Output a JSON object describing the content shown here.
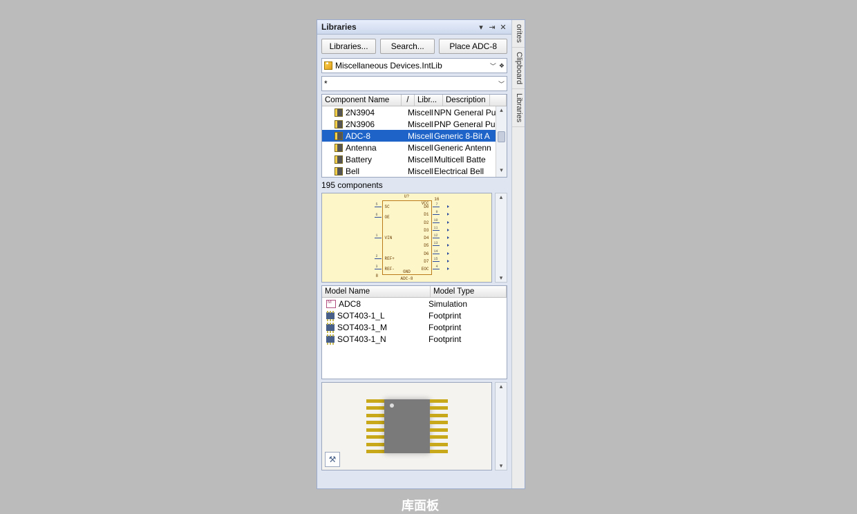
{
  "panel": {
    "title": "Libraries",
    "toolbar": {
      "libraries_btn": "Libraries...",
      "search_btn": "Search...",
      "place_btn": "Place ADC-8"
    },
    "library_combo": "Miscellaneous Devices.IntLib",
    "filter_value": "*",
    "columns": {
      "name": "Component Name",
      "sort": "/",
      "lib": "Libr...",
      "desc": "Description"
    },
    "rows": [
      {
        "name": "2N3904",
        "lib": "Miscell",
        "desc": "NPN General Pu"
      },
      {
        "name": "2N3906",
        "lib": "Miscell",
        "desc": "PNP General Pu"
      },
      {
        "name": "ADC-8",
        "lib": "Miscell",
        "desc": "Generic 8-Bit A",
        "selected": true
      },
      {
        "name": "Antenna",
        "lib": "Miscell",
        "desc": "Generic Antenn"
      },
      {
        "name": "Battery",
        "lib": "Miscell",
        "desc": "Multicell Batte"
      },
      {
        "name": "Bell",
        "lib": "Miscell",
        "desc": "Electrical Bell"
      }
    ],
    "count_text": "195 components",
    "schematic": {
      "designator": "U?",
      "part_name": "ADC-8",
      "left_pins": [
        {
          "n": "5",
          "lbl": "SC"
        },
        {
          "n": "6",
          "lbl": "OE"
        },
        {
          "n": "",
          "lbl": ""
        },
        {
          "n": "1",
          "lbl": "VIN"
        },
        {
          "n": "",
          "lbl": ""
        },
        {
          "n": "2",
          "lbl": "REF+"
        },
        {
          "n": "3",
          "lbl": "REF-"
        }
      ],
      "right_pins": [
        {
          "n": "7",
          "lbl": "D0"
        },
        {
          "n": "9",
          "lbl": "D1"
        },
        {
          "n": "10",
          "lbl": "D2"
        },
        {
          "n": "11",
          "lbl": "D3"
        },
        {
          "n": "12",
          "lbl": "D4"
        },
        {
          "n": "13",
          "lbl": "D5"
        },
        {
          "n": "14",
          "lbl": "D6"
        },
        {
          "n": "15",
          "lbl": "D7"
        },
        {
          "n": "4",
          "lbl": "EOC"
        }
      ],
      "top_pin": {
        "n": "16",
        "lbl": "VCC"
      },
      "bot_pin": {
        "n": "8",
        "lbl": "GND"
      }
    },
    "models": {
      "col_name": "Model Name",
      "col_type": "Model Type",
      "rows": [
        {
          "name": "ADC8",
          "type": "Simulation",
          "icon": "sim"
        },
        {
          "name": "SOT403-1_L",
          "type": "Footprint",
          "icon": "fp"
        },
        {
          "name": "SOT403-1_M",
          "type": "Footprint",
          "icon": "fp"
        },
        {
          "name": "SOT403-1_N",
          "type": "Footprint",
          "icon": "fp"
        }
      ]
    },
    "footprint_lead_count": 8
  },
  "sidetabs": {
    "t1": "orites",
    "t2": "Clipboard",
    "t3": "Libraries"
  },
  "caption": "库面板"
}
